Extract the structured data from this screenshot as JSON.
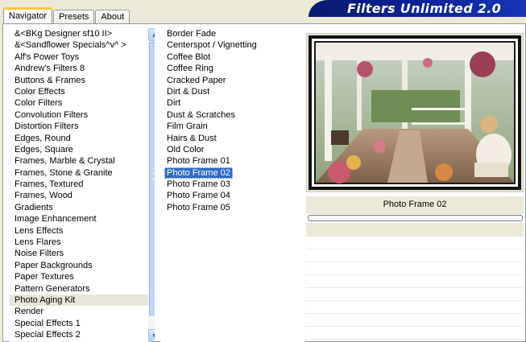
{
  "tabs": [
    {
      "label": "Navigator",
      "active": true
    },
    {
      "label": "Presets",
      "active": false
    },
    {
      "label": "About",
      "active": false
    }
  ],
  "banner": {
    "title": "Filters Unlimited 2.0"
  },
  "categories": {
    "items": [
      "&<BKg Designer sf10 II>",
      "&<Sandflower Specials^v^ >",
      "Alf's Power Toys",
      "Andrew's Filters 8",
      "Buttons & Frames",
      "Color Effects",
      "Color Filters",
      "Convolution Filters",
      "Distortion Filters",
      "Edges, Round",
      "Edges, Square",
      "Frames, Marble & Crystal",
      "Frames, Stone & Granite",
      "Frames, Textured",
      "Frames, Wood",
      "Gradients",
      "Image Enhancement",
      "Lens Effects",
      "Lens Flares",
      "Noise Filters",
      "Paper Backgrounds",
      "Paper Textures",
      "Pattern Generators",
      "Photo Aging Kit",
      "Render",
      "Special Effects 1",
      "Special Effects 2"
    ],
    "selected_index": 23
  },
  "filters": {
    "items": [
      "Border Fade",
      "Centerspot / Vignetting",
      "Coffee Blot",
      "Coffee Ring",
      "Cracked Paper",
      "Dirt & Dust",
      "Dirt",
      "Dust & Scratches",
      "Film Grain",
      "Hairs & Dust",
      "Old Color",
      "Photo Frame 01",
      "Photo Frame 02",
      "Photo Frame 03",
      "Photo Frame 04",
      "Photo Frame 05"
    ],
    "selected_index": 12
  },
  "preview": {
    "filter_name": "Photo Frame 02"
  },
  "icons": {
    "scroll_up": "chevron-up-icon",
    "scroll_down": "chevron-down-icon"
  },
  "colors": {
    "selection": "#316ac5",
    "banner": "#0b2296",
    "tab_highlight": "#ffc83c"
  }
}
